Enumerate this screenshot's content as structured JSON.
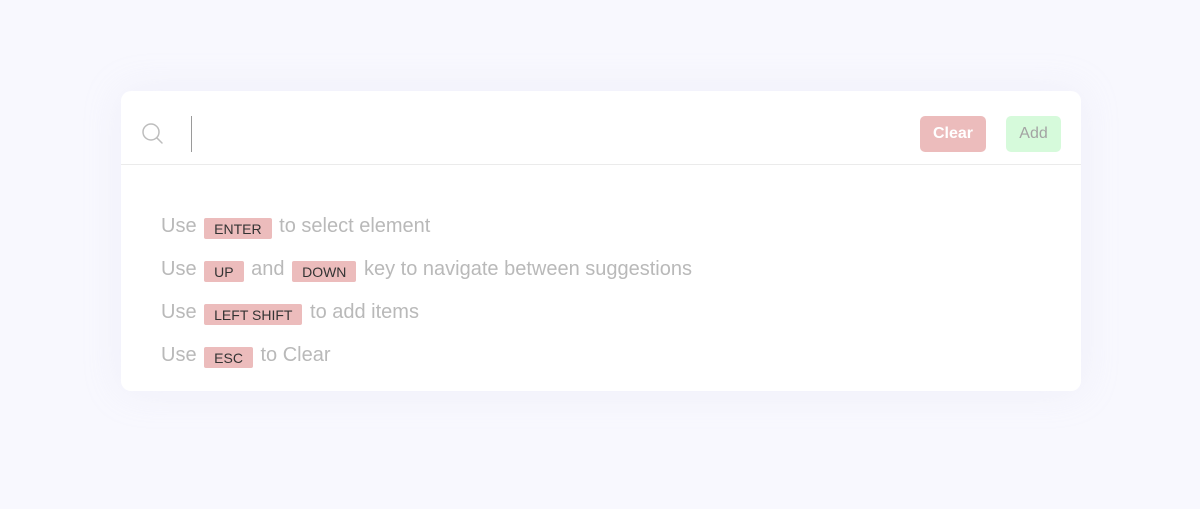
{
  "search": {
    "value": "",
    "placeholder": ""
  },
  "buttons": {
    "clear_label": "Clear",
    "add_label": "Add"
  },
  "hints": [
    {
      "prefix": "Use",
      "key1": "ENTER",
      "middle": "to select element"
    },
    {
      "prefix": "Use",
      "key1": "UP",
      "middle": "and",
      "key2": "DOWN",
      "suffix": "key to navigate between suggestions"
    },
    {
      "prefix": "Use",
      "key1": "LEFT SHIFT",
      "middle": "to add items"
    },
    {
      "prefix": "Use",
      "key1": "ESC",
      "middle": "to Clear"
    }
  ],
  "colors": {
    "background": "#f8f8fe",
    "clear_button": "#ecbcbc",
    "add_button": "#d6fadb",
    "key_badge": "#ecbcbc",
    "hint_text": "#b9b9b9"
  },
  "icons": {
    "search": "search-icon"
  }
}
